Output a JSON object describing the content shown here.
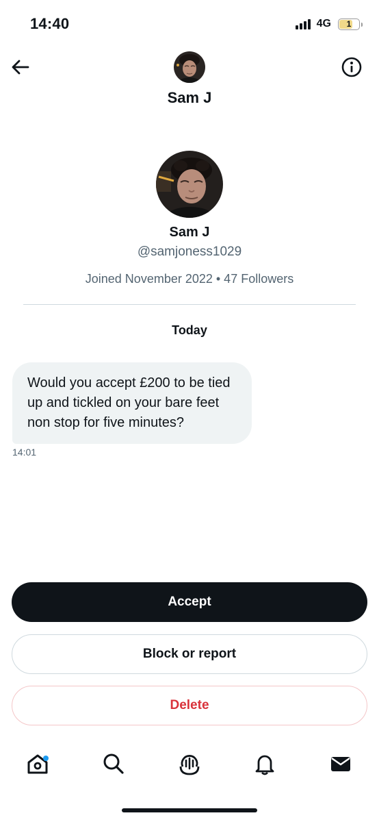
{
  "status_bar": {
    "time": "14:40",
    "network": "4G",
    "battery_label": "1"
  },
  "header": {
    "name": "Sam J",
    "back_icon": "arrow-left-icon",
    "info_icon": "info-circle-icon"
  },
  "profile": {
    "name": "Sam J",
    "handle": "@samjoness1029",
    "meta": "Joined November 2022 • 47 Followers"
  },
  "conversation": {
    "day_label": "Today",
    "messages": [
      {
        "text": "Would you accept £200 to be tied up and tickled on your bare feet non stop for five minutes?",
        "time": "14:01"
      }
    ]
  },
  "actions": {
    "accept_label": "Accept",
    "block_label": "Block or report",
    "delete_label": "Delete"
  },
  "nav": {
    "items": [
      "home-icon",
      "search-icon",
      "spaces-icon",
      "notifications-icon",
      "messages-icon"
    ],
    "home_has_notification": true
  },
  "colors": {
    "text_primary": "#0f1419",
    "text_secondary": "#536471",
    "bubble_bg": "#eff3f4",
    "accept_bg": "#0f1419",
    "delete_text": "#d9323a",
    "notification_dot": "#1d9bf0"
  }
}
